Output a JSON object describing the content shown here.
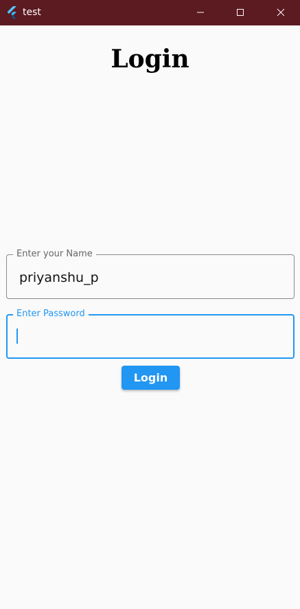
{
  "window": {
    "title": "test",
    "icons": {
      "app": "flutter-logo-icon",
      "minimize": "minimize-icon",
      "maximize": "maximize-icon",
      "close": "close-icon"
    },
    "colors": {
      "titlebar": "#5c1a21",
      "title_text": "#ffffff"
    }
  },
  "page": {
    "heading": "Login"
  },
  "form": {
    "name_field": {
      "label": "Enter your Name",
      "value": "priyanshu_p",
      "focused": false
    },
    "password_field": {
      "label": "Enter Password",
      "value": "",
      "focused": true
    },
    "submit_label": "Login"
  },
  "colors": {
    "accent": "#2196f3",
    "background": "#fafafa",
    "border_inactive": "#8a8a8a",
    "label_inactive": "#666666"
  }
}
